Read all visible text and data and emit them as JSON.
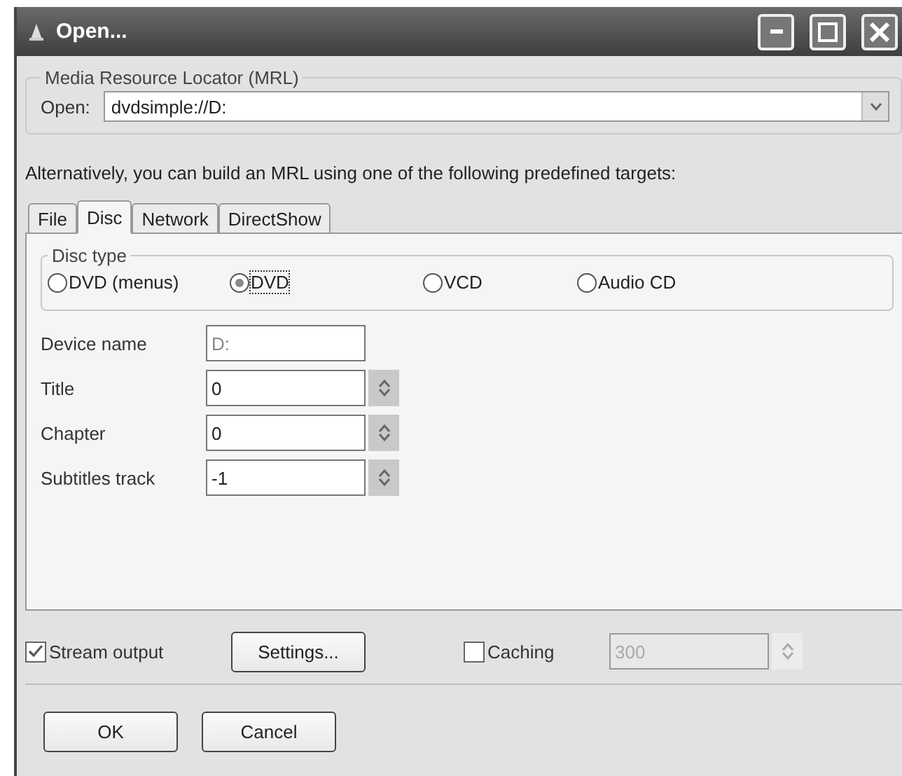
{
  "window": {
    "title": "Open..."
  },
  "mrl": {
    "legend": "Media Resource Locator (MRL)",
    "label": "Open:",
    "value": "dvdsimple://D:"
  },
  "hint": "Alternatively, you can build an MRL using one of the following predefined targets:",
  "tabs": [
    {
      "label": "File",
      "selected": false
    },
    {
      "label": "Disc",
      "selected": true
    },
    {
      "label": "Network",
      "selected": false
    },
    {
      "label": "DirectShow",
      "selected": false
    }
  ],
  "disc_type": {
    "legend": "Disc type",
    "options": [
      {
        "label": "DVD (menus)",
        "selected": false
      },
      {
        "label": "DVD",
        "selected": true
      },
      {
        "label": "VCD",
        "selected": false
      },
      {
        "label": "Audio CD",
        "selected": false
      }
    ]
  },
  "fields": [
    {
      "label": "Device name",
      "value": "D:",
      "kind": "text",
      "disabled": true
    },
    {
      "label": "Title",
      "value": "0",
      "kind": "spin",
      "disabled": false
    },
    {
      "label": "Chapter",
      "value": "0",
      "kind": "spin",
      "disabled": false
    },
    {
      "label": "Subtitles track",
      "value": "-1",
      "kind": "spin",
      "disabled": false
    }
  ],
  "stream_output": {
    "label": "Stream output",
    "checked": true
  },
  "settings_button": "Settings...",
  "caching": {
    "label": "Caching",
    "checked": false,
    "value": "300",
    "disabled": true
  },
  "buttons": [
    "OK",
    "Cancel"
  ]
}
